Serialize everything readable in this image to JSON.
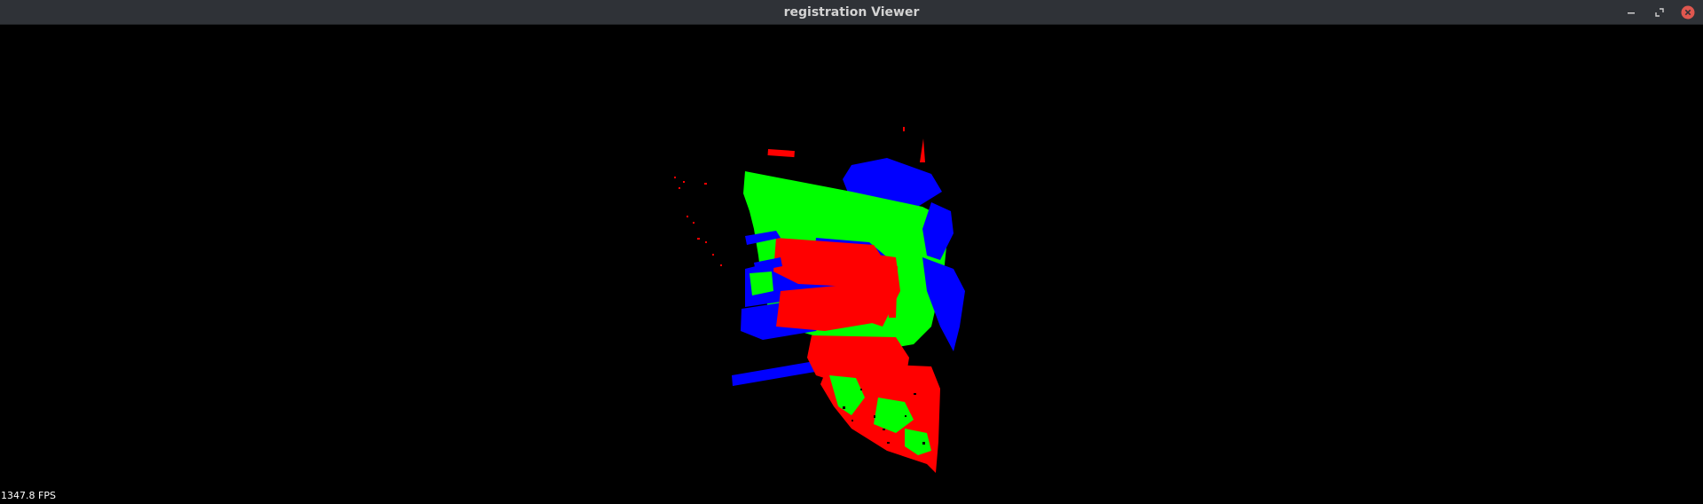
{
  "window": {
    "title": "registration Viewer",
    "controls": {
      "minimize_icon": "minimize-icon",
      "maximize_icon": "maximize-icon",
      "close_icon": "close-icon"
    }
  },
  "viewer": {
    "fps_text": "1347.8 FPS",
    "background_color": "#000000",
    "point_cloud_colors": {
      "cloud_a": "#ff0000",
      "cloud_b": "#00ff00",
      "cloud_c": "#0000ff"
    }
  }
}
